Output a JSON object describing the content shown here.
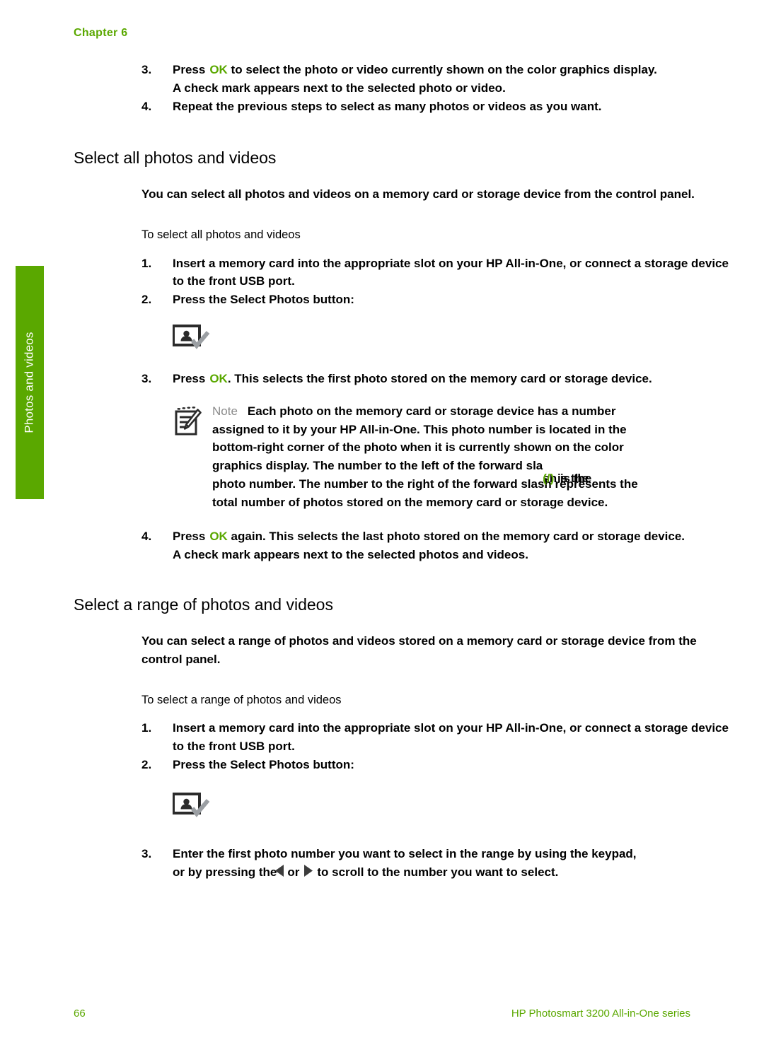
{
  "chapter": {
    "label": "Chapter 6"
  },
  "side_tab": {
    "label": "Photos and videos"
  },
  "steps_top": {
    "item3": {
      "num": "3.",
      "pre": "Press",
      "ok": "OK",
      "post": " to select the photo or video currently shown on the color graphics display."
    },
    "item3_result": "A check mark appears next to the selected photo or video.",
    "item4": {
      "num": "4.",
      "text": "Repeat the previous steps to select as many photos or videos as you want."
    }
  },
  "section_all": {
    "heading": "Select all photos and videos",
    "intro": "You can select all photos and videos on a memory card or storage device from the control panel.",
    "procedure_title": "To select all photos and videos",
    "step1": {
      "num": "1.",
      "text": "Insert a memory card into the appropriate slot on your HP All-in-One, or connect a storage device to the front USB port."
    },
    "step2": {
      "num": "2.",
      "text": "Press the Select Photos button:"
    },
    "step3": {
      "num": "3.",
      "pre": "Press",
      "ok": "OK",
      "post": ". This selects the first photo stored on the memory card or storage device."
    },
    "note": {
      "label": "Note",
      "line1": "Each photo on the memory card or storage device has a number",
      "line2": "assigned to it by your HP All-in-One. This photo number is located in the",
      "line3": "bottom-right corner of the photo when it is currently shown on the color",
      "line4_a": "graphics display. The number to the left of the forward sla",
      "line4_overlap_a": "sh is the",
      "line4_overlap_slash": "(/)",
      "line4_overlap_b": " is the",
      "line5": "photo number. The number to the right of the forward slash represents the",
      "line6": "total number of photos stored on the memory card or storage device."
    },
    "step4": {
      "num": "4.",
      "pre": "Press",
      "ok": "OK",
      "post": " again. This selects the last photo stored on the memory card or storage device."
    },
    "step4_result": "A check mark appears next to the selected photos and videos."
  },
  "section_range": {
    "heading": "Select a range of photos and videos",
    "intro": "You can select a range of photos and videos stored on a memory card or storage device from the control panel.",
    "procedure_title": "To select a range of photos and videos",
    "step1": {
      "num": "1.",
      "text": "Insert a memory card into the appropriate slot on your HP All-in-One, or connect a storage device to the front USB port."
    },
    "step2": {
      "num": "2.",
      "text": "Press the Select Photos button:"
    },
    "step3": {
      "num": "3.",
      "line1": "Enter the first photo number you want to select in the range by using the keypad,",
      "line2_a": "or by pressing the",
      "line2_or": "or",
      "line2_b": "to scroll to the number you want to select."
    }
  },
  "footer": {
    "page_number": "66",
    "product": "HP Photosmart 3200 All-in-One series"
  },
  "colors": {
    "brand_green": "#5aa800",
    "note_label_gray": "#8a8a8a",
    "text_black": "#000000"
  },
  "icons": {
    "select_photos_button": "select-photos-icon",
    "note": "note-pad-pencil-icon",
    "left_arrow": "left-arrow-icon",
    "right_arrow": "right-arrow-icon"
  }
}
